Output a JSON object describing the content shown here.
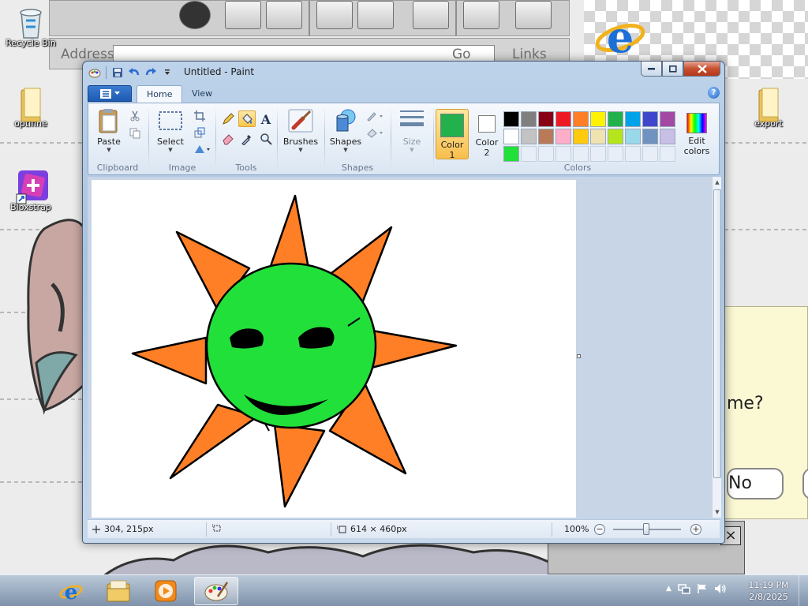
{
  "desktop": {
    "icons": [
      {
        "label": "Recycle Bin"
      },
      {
        "label": "optifine"
      },
      {
        "label": "Bloxstrap"
      },
      {
        "label": "export"
      }
    ],
    "background_app": {
      "address_label": "Address",
      "go_label": "Go",
      "links_label": "Links",
      "dialog_question": "me?",
      "dialog_no": "No"
    }
  },
  "paint": {
    "title": "Untitled - Paint",
    "file_tab_icon": "menu-icon",
    "tabs": [
      {
        "label": "Home",
        "active": true
      },
      {
        "label": "View",
        "active": false
      }
    ],
    "groups": {
      "clipboard": {
        "label": "Clipboard",
        "paste": "Paste"
      },
      "image": {
        "label": "Image",
        "select": "Select"
      },
      "tools": {
        "label": "Tools",
        "selected_tool": "fill-icon"
      },
      "brushes": {
        "label": "Brushes"
      },
      "shapes": {
        "label": "Shapes",
        "shapes_btn": "Shapes"
      },
      "size": {
        "label": "Size"
      },
      "colors": {
        "label": "Colors",
        "color1_label_line1": "Color",
        "color1_label_line2": "1",
        "color2_label_line1": "Color",
        "color2_label_line2": "2",
        "edit_line1": "Edit",
        "edit_line2": "colors",
        "color1": "#22b14c",
        "color2": "#ffffff",
        "palette_row1": [
          "#000000",
          "#7f7f7f",
          "#880015",
          "#ed1c24",
          "#ff7f27",
          "#fff200",
          "#22b14c",
          "#00a2e8",
          "#3f48cc",
          "#a349a4"
        ],
        "palette_row2": [
          "#ffffff",
          "#c3c3c3",
          "#b97a57",
          "#ffaec9",
          "#ffc90e",
          "#efe4b0",
          "#b5e61d",
          "#99d9ea",
          "#7092be",
          "#c8bfe7"
        ],
        "palette_row3": [
          "#22e03a",
          "",
          "",
          "",
          "",
          "",
          "",
          "",
          "",
          ""
        ]
      }
    },
    "status": {
      "cursor_pos": "304, 215px",
      "selection_size": "",
      "image_size": "614 × 460px",
      "zoom": "100%"
    },
    "drawing": {
      "sun_face_color": "#22e03a",
      "ray_color": "#ff7f27",
      "outline_color": "#000000"
    }
  },
  "taskbar": {
    "time": "11:19 PM",
    "date": "2/8/2025",
    "tray_chevron": "▲",
    "pinned": [
      "ie-icon",
      "explorer-icon",
      "media-player-icon",
      "paint-icon"
    ]
  }
}
